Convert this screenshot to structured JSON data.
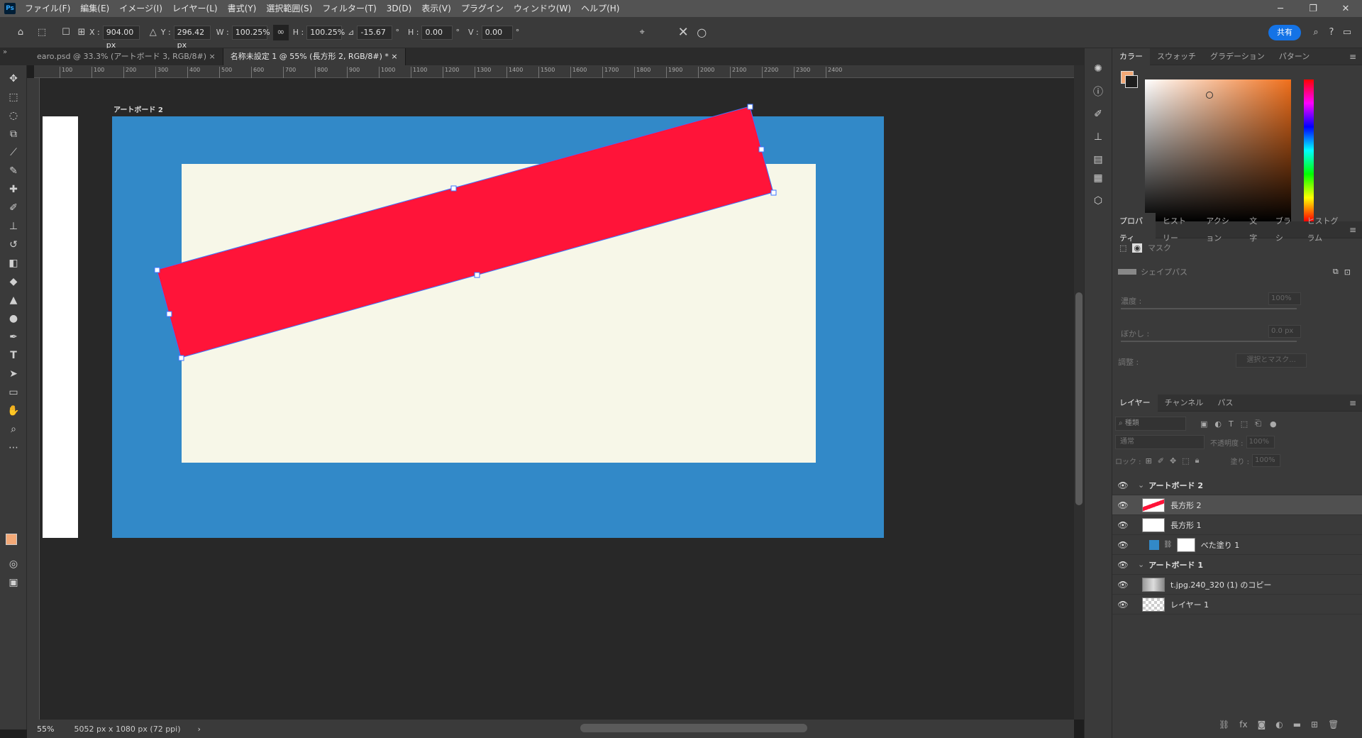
{
  "app": {
    "logo": "Ps"
  },
  "menu": [
    "ファイル(F)",
    "編集(E)",
    "イメージ(I)",
    "レイヤー(L)",
    "書式(Y)",
    "選択範囲(S)",
    "フィルター(T)",
    "3D(D)",
    "表示(V)",
    "プラグイン",
    "ウィンドウ(W)",
    "ヘルプ(H)"
  ],
  "options": {
    "x_label": "X :",
    "x_value": "904.00 px",
    "y_label": "Y :",
    "y_value": "296.42 px",
    "w_label": "W :",
    "w_value": "100.25%",
    "h_label": "H :",
    "h_value": "100.25%",
    "angle_value": "-15.67",
    "deg": "°",
    "hskew_label": "H :",
    "hskew_value": "0.00",
    "vskew_label": "V :",
    "vskew_value": "0.00",
    "share_label": "共有"
  },
  "tabs": [
    {
      "label": "earo.psd @ 33.3% (アートボード 3, RGB/8#)",
      "close": "×"
    },
    {
      "label": "名称未設定 1 @ 55% (長方形 2, RGB/8#) *",
      "close": "×"
    }
  ],
  "ruler": {
    "top": [
      "100",
      "100",
      "200",
      "300",
      "400",
      "500",
      "600",
      "700",
      "800",
      "900",
      "1000",
      "1100",
      "1200",
      "1300",
      "1400",
      "1500",
      "1600",
      "1700",
      "1800",
      "1900",
      "2000",
      "2100",
      "2200",
      "2300",
      "2400"
    ]
  },
  "canvas": {
    "artboard_label": "アートボード 2",
    "artboard_color": "#3289c8",
    "inner_color": "#f7f7e8",
    "shape_color": "#ff1439"
  },
  "status": {
    "zoom": "55%",
    "doc_info": "5052 px x 1080 px (72 ppi)",
    "arrow": "›"
  },
  "color_panel": {
    "tabs": [
      "カラー",
      "スウォッチ",
      "グラデーション",
      "パターン"
    ],
    "fg_color": "#f3a977",
    "bg_color": "#1e1e1e"
  },
  "properties": {
    "tabs": [
      "プロパティ",
      "ヒストリー",
      "アクション",
      "文字",
      "ブラシ",
      "ヒストグラム"
    ],
    "mask_label": "マスク",
    "shape_path_label": "シェイプパス",
    "density_label": "濃度 :",
    "density_value": "100%",
    "feather_label": "ぼかし :",
    "feather_value": "0.0 px",
    "adjust_label": "調整 :",
    "select_mask_label": "選択とマスク..."
  },
  "layers_panel": {
    "tabs": [
      "レイヤー",
      "チャンネル",
      "パス"
    ],
    "search_placeholder": "種類",
    "blend_mode": "通常",
    "opacity_label": "不透明度 :",
    "opacity_value": "100%",
    "lock_label": "ロック :",
    "fill_label": "塗り :",
    "fill_value": "100%",
    "layers": [
      {
        "name": "アートボード 2",
        "type": "group"
      },
      {
        "name": "長方形 2",
        "type": "layer",
        "selected": true
      },
      {
        "name": "長方形 1",
        "type": "layer"
      },
      {
        "name": "べた塗り 1",
        "type": "fill"
      },
      {
        "name": "アートボード 1",
        "type": "group"
      },
      {
        "name": "t.jpg.240_320 (1) のコピー",
        "type": "layer"
      },
      {
        "name": "レイヤー 1",
        "type": "layer"
      }
    ]
  }
}
